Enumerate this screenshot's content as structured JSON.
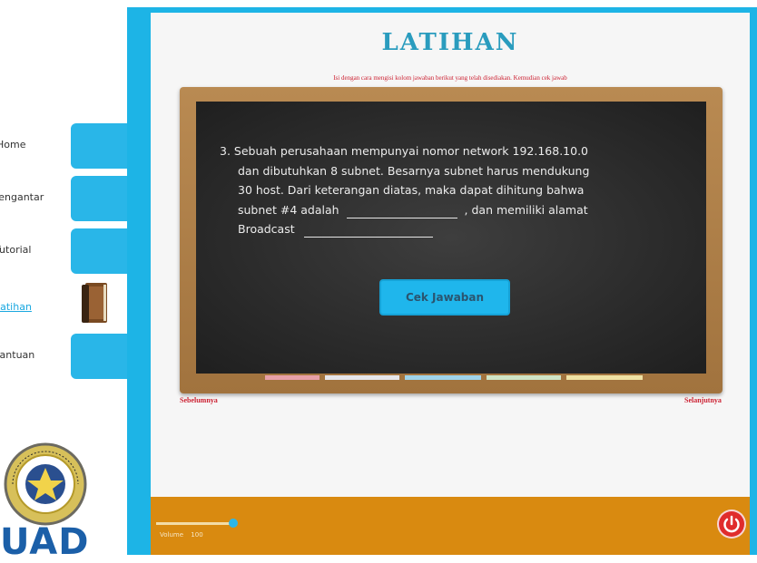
{
  "nav": {
    "items": [
      {
        "label": "Home",
        "active": false
      },
      {
        "label": "Pengantar",
        "active": false
      },
      {
        "label": "Tutorial",
        "active": false
      },
      {
        "label": "Latihan",
        "active": true
      },
      {
        "label": "Bantuan",
        "active": false
      }
    ]
  },
  "logo": {
    "seal_text": "UNIVERSITAS AHMAD DAHLAN",
    "short_name": "UAD"
  },
  "page": {
    "title": "LATIHAN",
    "instruction": "Isi dengan cara mengisi kolom jawaban berikut yang telah disediakan. Kemudian cek jawab"
  },
  "question": {
    "lines": [
      "3. Sebuah perusahaan mempunyai nomor network 192.168.10.0",
      "dan dibutuhkan 8 subnet. Besarnya subnet harus mendukung",
      "30 host. Dari keterangan diatas, maka dapat dihitung bahwa"
    ],
    "line4_prefix": "subnet #4 adalah",
    "line4_suffix": ", dan  memiliki alamat",
    "line5_prefix": "Broadcast",
    "answer1_value": "",
    "answer2_value": ""
  },
  "buttons": {
    "check": "Cek Jawaban",
    "previous": "Sebelumnya",
    "next": "Selanjutnya"
  },
  "footer": {
    "volume_label": "Volume",
    "volume_value": "100",
    "volume_level": 1.0
  },
  "colors": {
    "accent": "#1db4e6",
    "bar": "#d98a10",
    "title": "#2a9cbe",
    "link": "#cc2233",
    "power": "#e02c2c"
  },
  "icons": {
    "book": "book-icon",
    "power": "power-icon",
    "seal": "university-seal"
  }
}
